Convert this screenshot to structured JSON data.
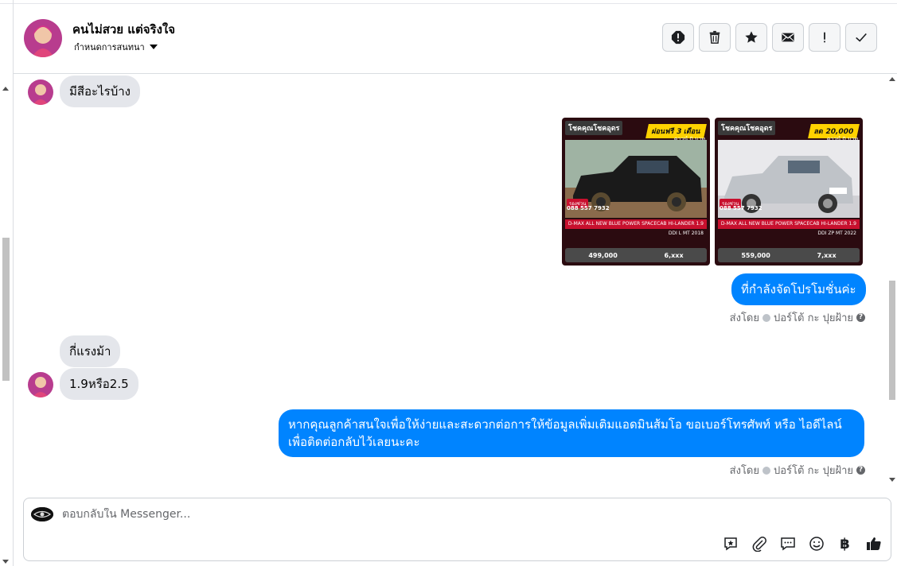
{
  "colors": {
    "outgoing_bubble": "#0084ff",
    "incoming_bubble": "#e4e6eb",
    "meta_text": "#65676b"
  },
  "header": {
    "contact_name": "คนไม่สวย แต่จริงใจ",
    "assign_label": "กำหนดการสนทนา",
    "actions": [
      {
        "icon": "alert-circle-icon"
      },
      {
        "icon": "trash-icon"
      },
      {
        "icon": "star-icon"
      },
      {
        "icon": "envelope-icon"
      },
      {
        "icon": "exclamation-icon"
      },
      {
        "icon": "checkmark-icon"
      }
    ]
  },
  "messages": {
    "in_1": "มีสีอะไรบ้าง",
    "out_1": "ที่กำลังจัดโปรโมชั่นค่ะ",
    "in_2": "กี่แรงม้า",
    "in_3": "1.9หรือ2.5",
    "out_2": "หากคุณลูกค้าสนใจเพื่อให้ง่ายและสะดวกต่อการให้ข้อมูลเพิ่มเติมแอดมินส้มโอ ขอเบอร์โทรศัพท์ หรือ ไอดีไลน์ เพื่อติดต่อกลับไว้เลยนะคะ"
  },
  "sent_by": {
    "prefix": "ส่งโดย",
    "agent": "ปอร์โต้ กะ ปุยฝ้าย"
  },
  "promo_cards": [
    {
      "brand": "โชคคุณโชคอุดร",
      "promo": "ผ่อนฟรี 3 เดือน",
      "down": "ดาวน์ 0 บาท",
      "phone": "088 557 7932",
      "tag": "รองช่วน",
      "model": "D-MAX ALL NEW BLUE POWER SPACECAB HI-LANDER 1.9 DDI L MT 2018",
      "price": "499,000",
      "installment": "6,xxx"
    },
    {
      "brand": "โชคคุณโชคอุดร",
      "promo": "ลด 20,000",
      "down": "ดาวน์ 0 บาท",
      "phone": "088 557 7932",
      "tag": "รองช่วน",
      "model": "D-MAX ALL NEW BLUE POWER SPACECAB HI-LANDER 1.9 DDI ZP MT 2022",
      "price": "559,000",
      "installment": "7,xxx"
    }
  ],
  "composer": {
    "placeholder": "ตอบกลับใน Messenger..."
  }
}
